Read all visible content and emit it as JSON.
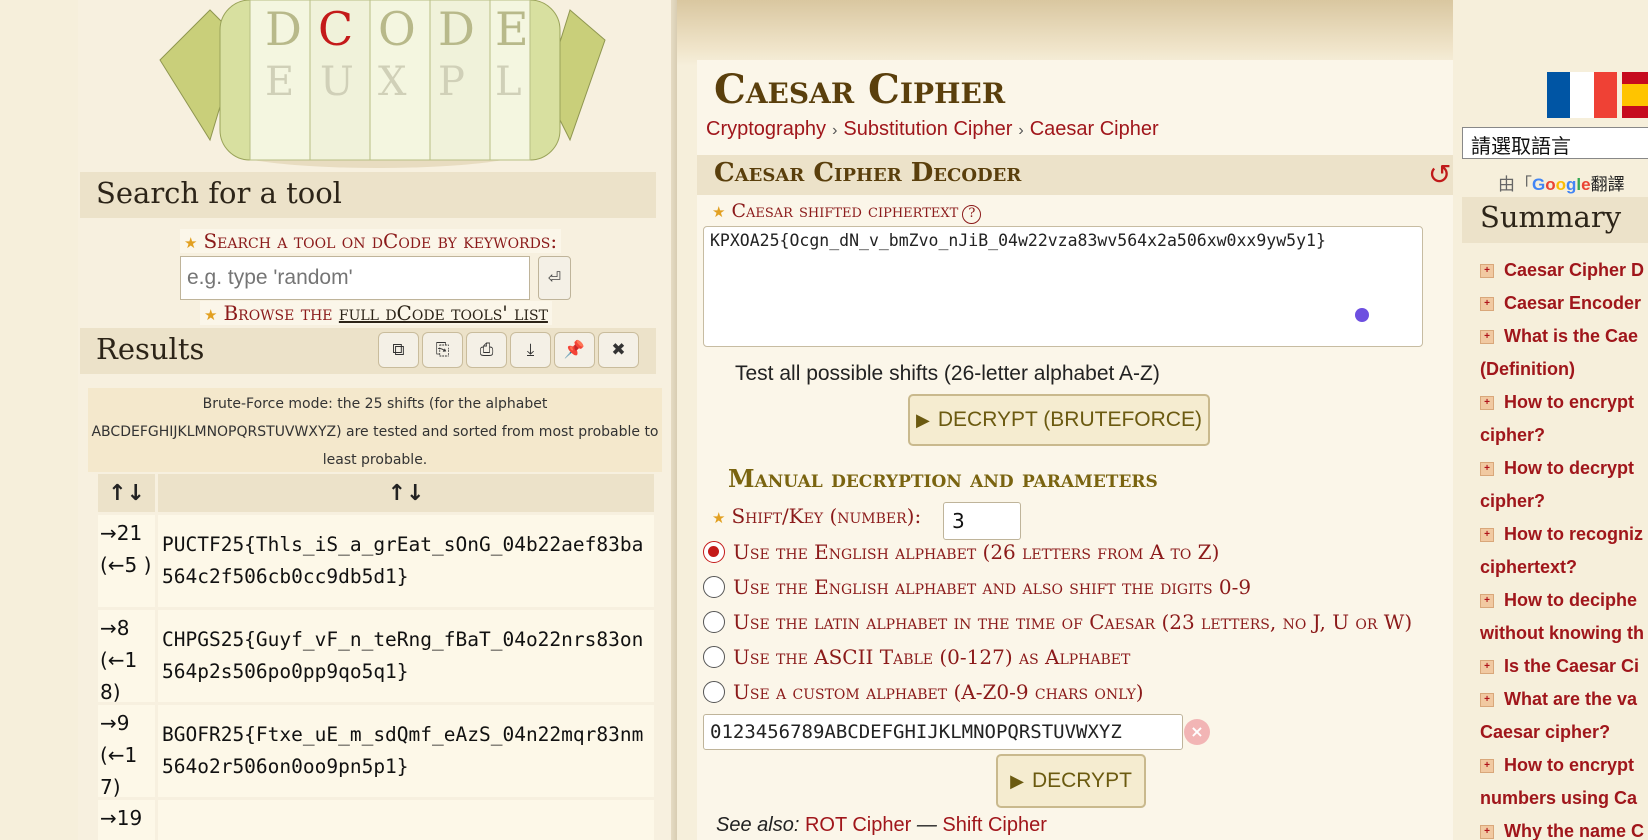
{
  "left": {
    "search_section_title": "Search for a tool",
    "search_label": "Search a tool on dCode by keywords:",
    "search_placeholder": "e.g. type 'random'",
    "browse_prefix": "Browse the ",
    "browse_link": "full dCode tools' list",
    "results_title": "Results",
    "bruteforce_note_line1": "Brute-Force mode: the 25 shifts (for the alphabet",
    "bruteforce_note_line2": "ABCDEFGHIJKLMNOPQRSTUVWXYZ) are tested and sorted from most probable to",
    "bruteforce_note_line3": "least probable.",
    "table_headers": [
      "↑↓",
      "↑↓"
    ],
    "rows": [
      {
        "key": "→21 (←5 )",
        "value": "PUCTF25{Thls_iS_a_grEat_sOnG_04b22aef83ba564c2f506cb0cc9db5d1}"
      },
      {
        "key": "→8 (←1 8)",
        "value": "CHPGS25{Guyf_vF_n_teRng_fBaT_04o22nrs83on564p2s506po0pp9qo5q1}"
      },
      {
        "key": "→9 (←1 7)",
        "value": "BGOFR25{Ftxe_uE_m_sdQmf_eAzS_04n22mqr83nm564o2r506on0oo9pn5p1}"
      },
      {
        "key": "→19",
        "value": ""
      }
    ]
  },
  "main": {
    "page_title": "Caesar Cipher",
    "breadcrumbs": [
      "Cryptography",
      "Substitution Cipher",
      "Caesar Cipher"
    ],
    "decoder_title": "Caesar Cipher Decoder",
    "ciphertext_label": "Caesar shifted ciphertext",
    "ciphertext_value": "KPXOA25{Ocgn_dN_v_bmZvo_nJiB_04w22vza83wv564x2a506xw0xx9yw5y1}",
    "test_all_label": "Test all possible shifts (26-letter alphabet A-Z)",
    "bruteforce_button": "DECRYPT (BRUTEFORCE)",
    "manual_title": "Manual decryption and parameters",
    "shift_label": "Shift/Key (number):",
    "shift_value": "3",
    "radio_options": [
      "Use the English alphabet (26 letters from A to Z)",
      "Use the English alphabet and also shift the digits 0-9",
      "Use the latin alphabet in the time of Caesar (23 letters, no J, U or W)",
      "Use the ASCII Table (0-127) as Alphabet",
      "Use a custom alphabet (A-Z0-9 chars only)"
    ],
    "custom_alphabet": "0123456789ABCDEFGHIJKLMNOPQRSTUVWXYZ",
    "decrypt_button": "DECRYPT",
    "see_also_label": "See also:",
    "see_also_links": [
      "ROT Cipher",
      "Shift Cipher"
    ],
    "see_also_sep": "—"
  },
  "right": {
    "lang_select": "請選取語言",
    "gtrans_prefix": "由「",
    "gtrans_google": "Google",
    "gtrans_suffix": "翻譯",
    "summary_title": "Summary",
    "summary_items": [
      "Caesar Cipher D",
      "Caesar Encoder",
      "What is the Cae",
      "(Definition)",
      "How to encrypt",
      "cipher?",
      "How to decrypt",
      "cipher?",
      "How to recogniz",
      "ciphertext?",
      "How to deciphe",
      "without knowing th",
      "Is the Caesar Ci",
      "What are the va",
      "Caesar cipher?",
      "How to encrypt",
      "numbers using Ca",
      "Why the name C"
    ],
    "summary_bullets": [
      true,
      true,
      true,
      false,
      true,
      false,
      true,
      false,
      true,
      false,
      true,
      false,
      true,
      true,
      false,
      true,
      false,
      true
    ]
  },
  "colors": {
    "accent_red": "#a0161b",
    "title_brown": "#5a3f0c",
    "panel_beige": "#ece2c9"
  }
}
